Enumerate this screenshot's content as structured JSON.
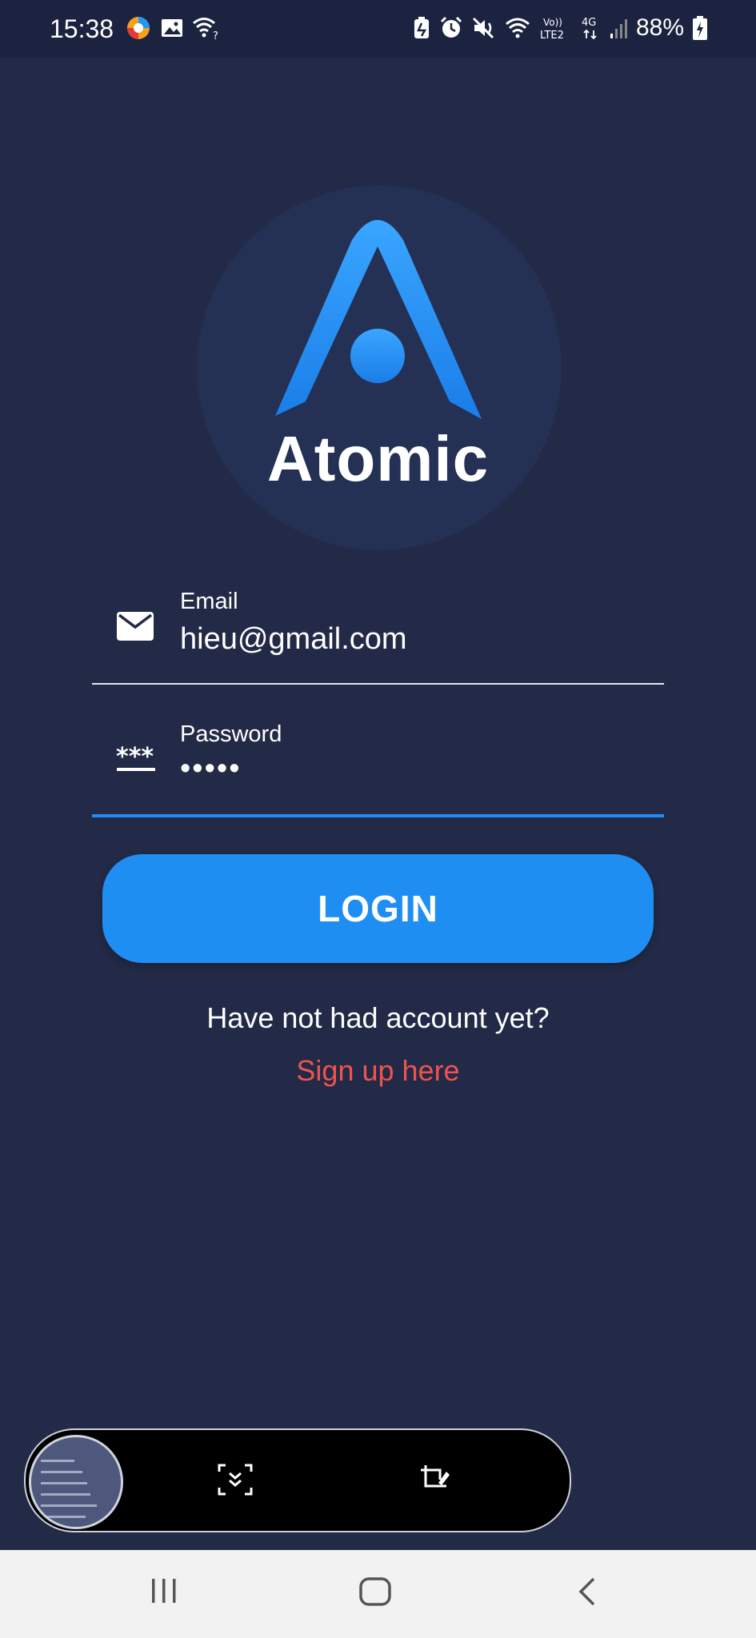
{
  "status_bar": {
    "time": "15:38",
    "network": "4G",
    "volte": "Vo)) LTE2",
    "battery": "88%",
    "left_icons": [
      "browser-icon",
      "gallery-icon",
      "wifi-question-icon"
    ],
    "right_icons": [
      "battery-saver-icon",
      "alarm-icon",
      "mute-icon",
      "wifi-icon",
      "signal-icon",
      "battery-icon"
    ]
  },
  "logo": {
    "text": "Atomic",
    "colors": {
      "gradient_top": "#3aa6ff",
      "gradient_bottom": "#1a7de8",
      "circle_bg": "#243054"
    }
  },
  "form": {
    "email": {
      "label": "Email",
      "value": "hieu@gmail.com",
      "icon": "mail-icon"
    },
    "password": {
      "label": "Password",
      "value": "•••••",
      "icon": "password-icon"
    }
  },
  "login_button": {
    "label": "LOGIN",
    "color": "#1f8ef3"
  },
  "signup_prompt": {
    "text": "Have not had account yet?",
    "link": "Sign up here",
    "link_color": "#ef5350"
  },
  "screenshot_toolbar": {
    "icons": [
      "scroll-capture-icon",
      "crop-edit-icon"
    ]
  },
  "nav_bar": {
    "icons": [
      "recents-icon",
      "home-icon",
      "back-icon"
    ]
  },
  "colors": {
    "background": "#222a47",
    "accent": "#1f8ef3",
    "focus_underline": "#1f8ef3"
  }
}
